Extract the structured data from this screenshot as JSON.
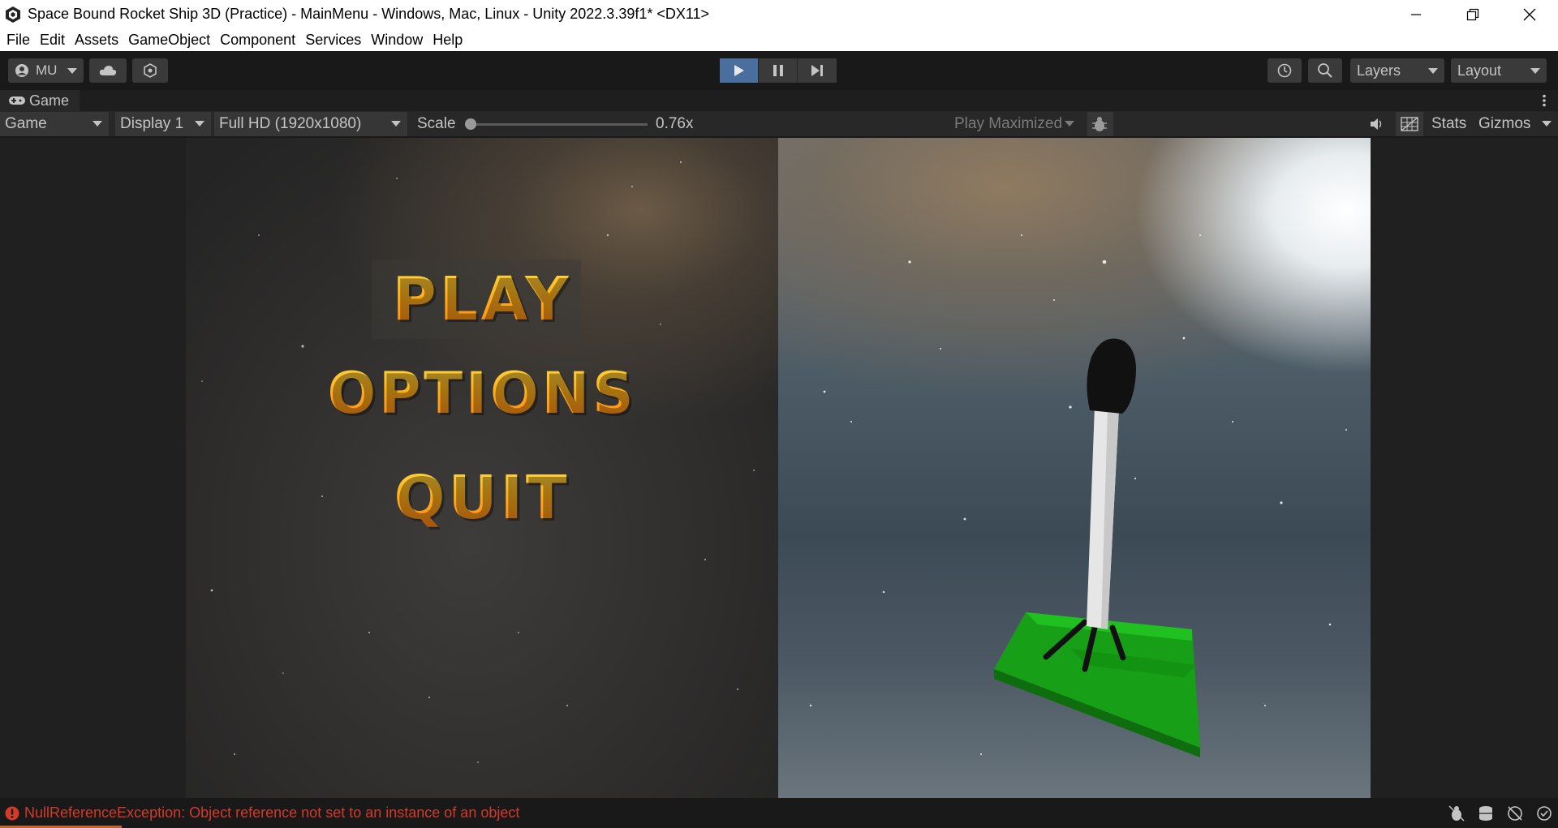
{
  "window": {
    "title": "Space Bound Rocket Ship 3D (Practice) - MainMenu - Windows, Mac, Linux - Unity 2022.3.39f1* <DX11>"
  },
  "menu": [
    "File",
    "Edit",
    "Assets",
    "GameObject",
    "Component",
    "Services",
    "Window",
    "Help"
  ],
  "toolbar": {
    "account_label": "MU",
    "layers_label": "Layers",
    "layout_label": "Layout"
  },
  "tab": {
    "label": "Game"
  },
  "game_toolbar": {
    "view_mode": "Game",
    "display": "Display 1",
    "resolution": "Full HD (1920x1080)",
    "scale_label": "Scale",
    "scale_value": "0.76x",
    "scale_fraction": 0.0,
    "play_mode": "Play Maximized",
    "stats_label": "Stats",
    "gizmos_label": "Gizmos"
  },
  "game_menu": {
    "play": "PLAY",
    "options": "OPTIONS",
    "quit": "QUIT"
  },
  "status": {
    "message": "NullReferenceException: Object reference not set to an instance of an object"
  },
  "colors": {
    "play_active": "#4a6f9e",
    "error": "#d23a2a",
    "platform": "#1fb51f",
    "button_text": "#ffb21c"
  }
}
